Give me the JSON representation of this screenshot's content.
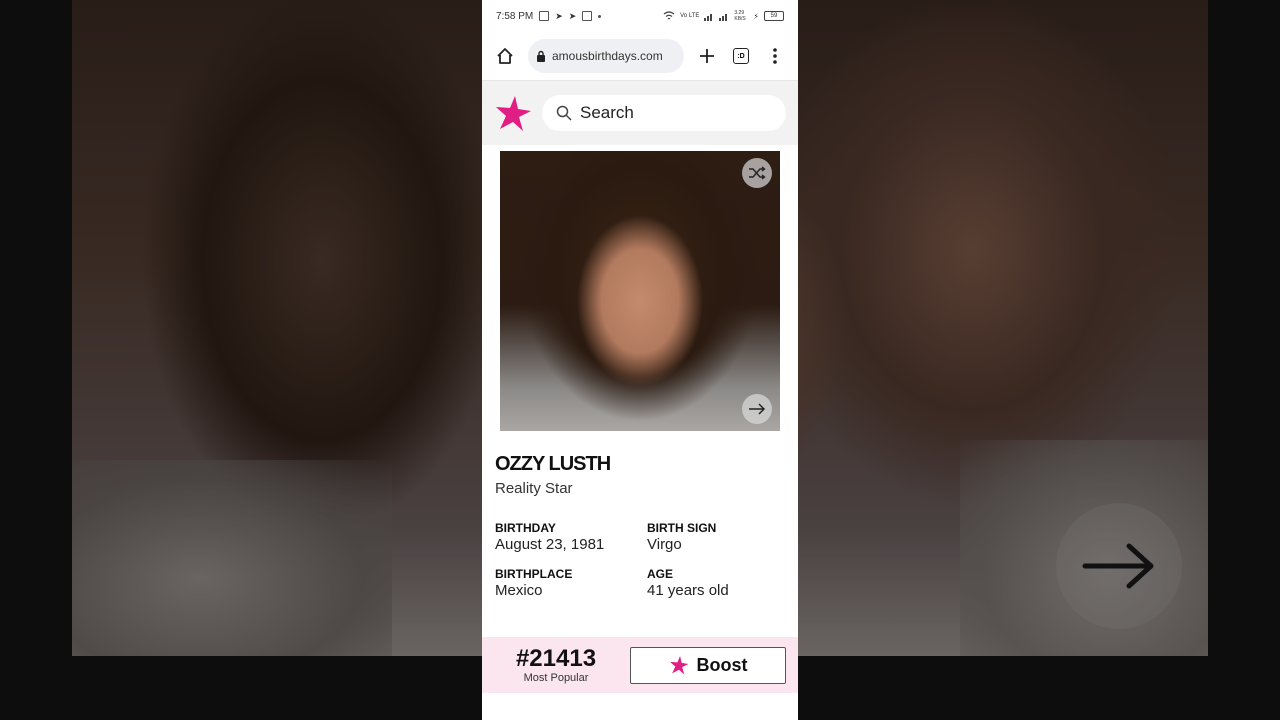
{
  "colors": {
    "brand_pink": "#e01e84",
    "rank_bar_bg": "#fbe5ef"
  },
  "status_bar": {
    "time": "7:58 PM",
    "network": "3.29 KB/S",
    "battery": "59"
  },
  "browser": {
    "url": "amousbirthdays.com",
    "tab_count": ":D",
    "icons": [
      "home-icon",
      "lock-icon",
      "plus-icon",
      "tab-switcher-icon",
      "more-vert-icon"
    ]
  },
  "site": {
    "search_placeholder": "Search"
  },
  "profile": {
    "name": "OZZY LUSTH",
    "profession": "Reality Star",
    "facts": [
      {
        "label": "BIRTHDAY",
        "value": "August 23, 1981"
      },
      {
        "label": "BIRTH SIGN",
        "value": "Virgo"
      },
      {
        "label": "BIRTHPLACE",
        "value": "Mexico"
      },
      {
        "label": "AGE",
        "value": "41 years old"
      }
    ]
  },
  "rank": {
    "number": "#21413",
    "label": "Most Popular",
    "boost_label": "Boost"
  }
}
